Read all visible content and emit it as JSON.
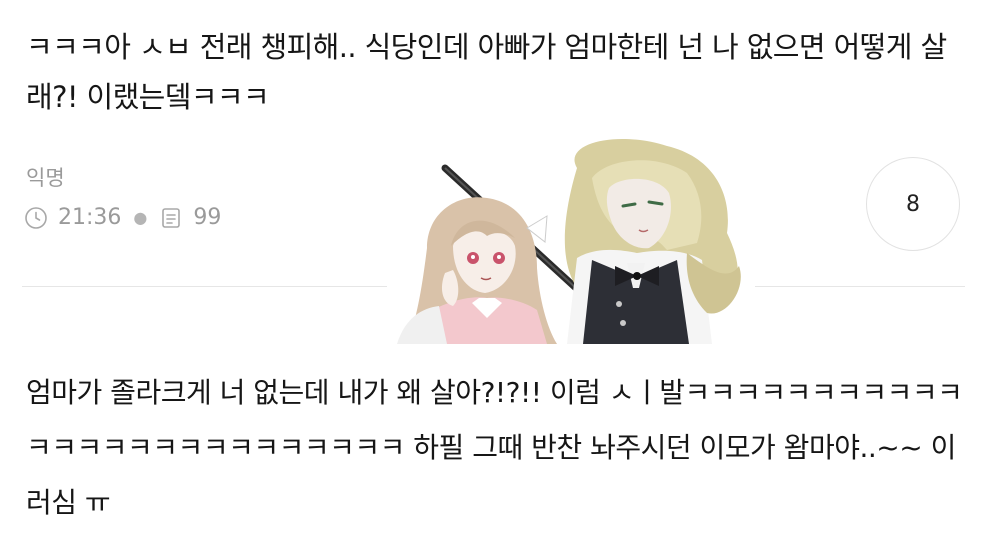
{
  "post": {
    "title": "ㅋㅋㅋ아 ㅅㅂ 전래 챙피해.. 식당인데 아빠가 엄마한테 넌 나 없으면 어떻게 살래?! 이랬는뎈ㅋㅋㅋ",
    "author": "익명",
    "time": "21:36",
    "views": "99",
    "comment_count": "8"
  },
  "comment": {
    "text": "엄마가 졸라크게 너 없는데 내가 왜 살아?!?!! 이럼 ㅅㅣ발ㅋㅋㅋㅋㅋㅋㅋㅋㅋㅋㅋ ㅋㅋㅋㅋㅋㅋㅋㅋㅋㅋㅋㅋㅋㅋㅋ 하필 그때 반찬 놔주시던 이모가 왐마야..~~ 이러심 ㅠ"
  },
  "icons": {
    "time": "clock-icon",
    "views": "document-icon"
  },
  "colors": {
    "text": "#161616",
    "meta": "#9a9a9a",
    "divider": "#e6e6e6",
    "circle_border": "#e2e2e2"
  }
}
